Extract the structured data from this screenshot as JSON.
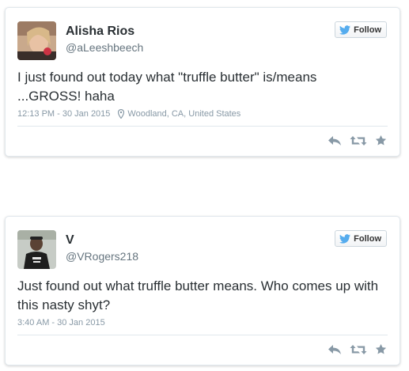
{
  "tweets": [
    {
      "display_name": "Alisha Rios",
      "username": "@aLeeshbeech",
      "text": "I just found out today what \"truffle butter\" is/means ...GROSS! haha",
      "timestamp": "12:13 PM - 30 Jan 2015",
      "location": "Woodland, CA, United States",
      "follow_label": "Follow",
      "avatar": "avatar-photo"
    },
    {
      "display_name": "V",
      "username": "@VRogers218",
      "text": "Just found out what truffle butter means. Who comes up with this nasty shyt?",
      "timestamp": "3:40 AM - 30 Jan 2015",
      "follow_label": "Follow",
      "avatar": "avatar-photo"
    }
  ],
  "icons": {
    "follow": "twitter-bird-icon",
    "location": "map-pin-icon",
    "reply": "reply-icon",
    "retweet": "retweet-icon",
    "favorite": "star-icon"
  },
  "colors": {
    "twitter_blue": "#55acee",
    "action_gray": "#8899a6",
    "name": "#292f33",
    "meta": "#66757f"
  }
}
